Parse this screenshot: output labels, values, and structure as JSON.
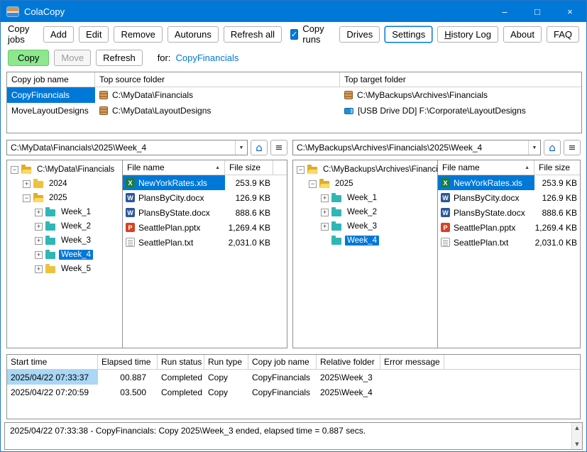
{
  "colors": {
    "titlebar_blue": "#0078d7",
    "selection_blue": "#0078d7",
    "selection_light_blue": "#a9d7f5",
    "copy_button_green": "#8de88d",
    "folder_yellow": "#edc23f",
    "folder_teal": "#2fb7b7",
    "excel_green": "#1e7b45",
    "word_blue": "#2b579a",
    "powerpoint_orange": "#d14424",
    "link_blue": "#0078d7"
  },
  "icons": {
    "minimize": "–",
    "maximize": "□",
    "close": "×",
    "checkmark": "✓",
    "dropdown": "▼",
    "folder_home": "⌂",
    "hamburger": "≡",
    "sort_asc": "▲",
    "expand": "+",
    "collapse": "−",
    "scroll_up": "▲",
    "scroll_down": "▼"
  },
  "titlebar": {
    "title": "ColaCopy"
  },
  "toolbar": {
    "copy_jobs_label": "Copy jobs",
    "add": "Add",
    "edit": "Edit",
    "remove": "Remove",
    "autoruns": "Autoruns",
    "refresh_all": "Refresh all",
    "copy_runs": "Copy runs",
    "drives": "Drives",
    "settings": "Settings",
    "history_log": "History Log",
    "about": "About",
    "faq": "FAQ"
  },
  "actions": {
    "copy": "Copy",
    "move": "Move",
    "refresh": "Refresh",
    "for_label": "for:",
    "current_job": "CopyFinancials"
  },
  "jobs": {
    "headers": [
      "Copy job name",
      "Top source folder",
      "Top target folder"
    ],
    "rows": [
      {
        "name": "CopyFinancials",
        "source": "C:\\MyData\\Financials",
        "target": "C:\\MyBackups\\Archives\\Financials"
      },
      {
        "name": "MoveLayoutDesigns",
        "source": "C:\\MyData\\LayoutDesigns",
        "target": "[USB Drive DD] F:\\Corporate\\LayoutDesigns"
      }
    ]
  },
  "left": {
    "path": "C:\\MyData\\Financials\\2025\\Week_4",
    "tree_root": "C:\\MyData\\Financials",
    "tree": [
      {
        "label": "2024"
      },
      {
        "label": "2025"
      },
      {
        "label": "Week_1"
      },
      {
        "label": "Week_2"
      },
      {
        "label": "Week_3"
      },
      {
        "label": "Week_4"
      },
      {
        "label": "Week_5"
      }
    ],
    "file_headers": [
      "File name",
      "File size"
    ],
    "files": [
      {
        "name": "NewYorkRates.xls",
        "size": "253.9 KB"
      },
      {
        "name": "PlansByCity.docx",
        "size": "126.9 KB"
      },
      {
        "name": "PlansByState.docx",
        "size": "888.6 KB"
      },
      {
        "name": "SeattlePlan.pptx",
        "size": "1,269.4 KB"
      },
      {
        "name": "SeattlePlan.txt",
        "size": "2,031.0 KB"
      }
    ]
  },
  "right": {
    "path": "C:\\MyBackups\\Archives\\Financials\\2025\\Week_4",
    "tree_root": "C:\\MyBackups\\Archives\\Financials",
    "tree": [
      {
        "label": "2025"
      },
      {
        "label": "Week_1"
      },
      {
        "label": "Week_2"
      },
      {
        "label": "Week_3"
      },
      {
        "label": "Week_4"
      }
    ],
    "file_headers": [
      "File name",
      "File size"
    ],
    "files": [
      {
        "name": "NewYorkRates.xls",
        "size": "253.9 KB"
      },
      {
        "name": "PlansByCity.docx",
        "size": "126.9 KB"
      },
      {
        "name": "PlansByState.docx",
        "size": "888.6 KB"
      },
      {
        "name": "SeattlePlan.pptx",
        "size": "1,269.4 KB"
      },
      {
        "name": "SeattlePlan.txt",
        "size": "2,031.0 KB"
      }
    ]
  },
  "log": {
    "headers": [
      "Start time",
      "Elapsed time",
      "Run status",
      "Run type",
      "Copy job name",
      "Relative folder",
      "Error message"
    ],
    "rows": [
      {
        "start": "2025/04/22 07:33:37",
        "elapsed": "00.887",
        "status": "Completed",
        "type": "Copy",
        "job": "CopyFinancials",
        "folder": "2025\\Week_3",
        "error": ""
      },
      {
        "start": "2025/04/22 07:20:59",
        "elapsed": "03.500",
        "status": "Completed",
        "type": "Copy",
        "job": "CopyFinancials",
        "folder": "2025\\Week_4",
        "error": ""
      }
    ]
  },
  "status": {
    "message": "2025/04/22 07:33:38 - CopyFinancials: Copy 2025\\Week_3 ended, elapsed time = 0.887 secs."
  }
}
